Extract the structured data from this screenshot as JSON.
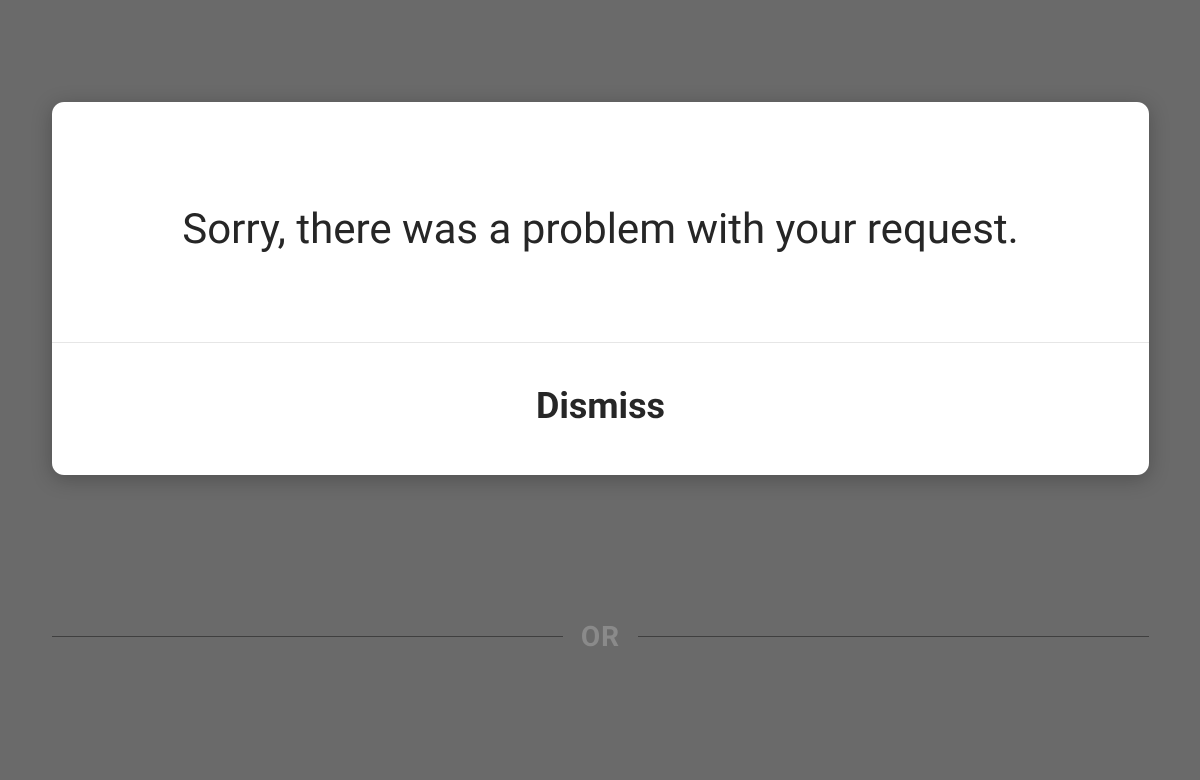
{
  "modal": {
    "message": "Sorry, there was a problem with your request.",
    "dismiss_label": "Dismiss"
  },
  "background": {
    "separator_label": "OR"
  }
}
